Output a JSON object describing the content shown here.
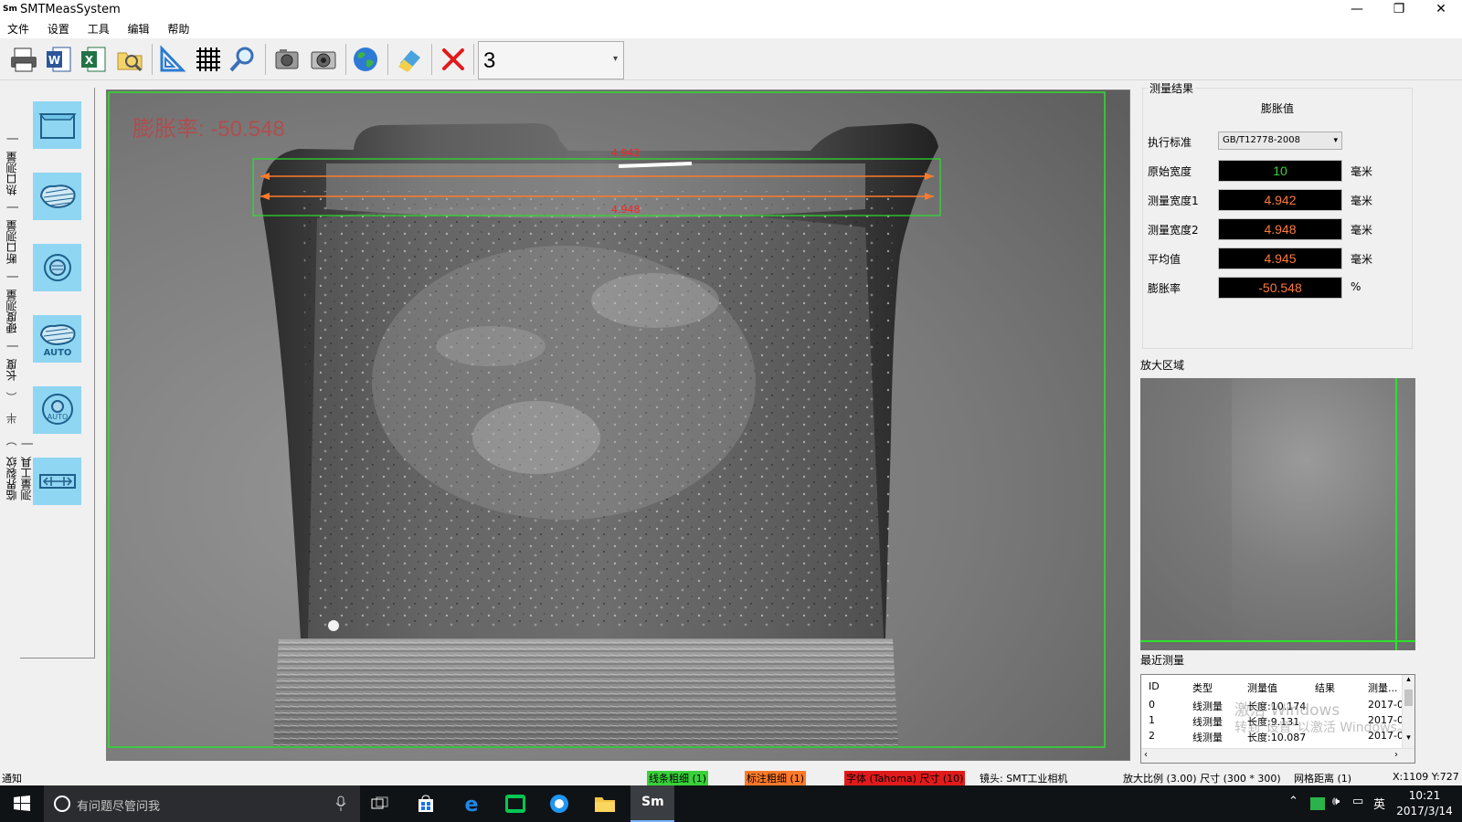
{
  "window": {
    "title": "SMTMeasSystem",
    "app_icon_text": "Sm",
    "minimize": "—",
    "maximize": "❐",
    "close": "✕"
  },
  "menu": [
    "文件",
    "设置",
    "工具",
    "编辑",
    "帮助"
  ],
  "toolbar": {
    "combo_value": "3",
    "icons": [
      "print-icon",
      "word-export-icon",
      "excel-export-icon",
      "open-image-icon",
      "ruler-icon",
      "grid-icon",
      "magnifier-icon",
      "camera-icon",
      "camera-capture-icon",
      "globe-icon",
      "eraser-icon",
      "delete-icon"
    ]
  },
  "left_tabs": [
    "测量工具",
    "|",
    "热口测量",
    "|",
    "断口测量",
    "|",
    "硬度测量",
    "|",
    "长度",
    "（",
    "半",
    "）",
    "临界裂纹",
    "|"
  ],
  "left_tools": [
    {
      "name": "rect-tool",
      "label": ""
    },
    {
      "name": "area-tool",
      "label": ""
    },
    {
      "name": "circle-tool",
      "label": ""
    },
    {
      "name": "auto-area-tool",
      "label": "AUTO"
    },
    {
      "name": "auto-circle-tool",
      "label": "AUTO"
    },
    {
      "name": "width-tool",
      "label": ""
    }
  ],
  "image": {
    "overlay_text": "膨胀率: -50.548",
    "line1_label": "4.942",
    "line2_label": "4.948"
  },
  "results": {
    "group_title": "测量结果",
    "subtitle": "膨胀值",
    "standard_label": "执行标准",
    "standard_value": "GB/T12778-2008",
    "rows": [
      {
        "label": "原始宽度",
        "value": "10",
        "unit": "毫米",
        "color": "#39d139"
      },
      {
        "label": "测量宽度1",
        "value": "4.942",
        "unit": "毫米",
        "color": "#ff7a3a"
      },
      {
        "label": "测量宽度2",
        "value": "4.948",
        "unit": "毫米",
        "color": "#ff7a3a"
      },
      {
        "label": "平均值",
        "value": "4.945",
        "unit": "毫米",
        "color": "#ff7a3a"
      },
      {
        "label": "膨胀率",
        "value": "-50.548",
        "unit": "%",
        "color": "#ff7a3a"
      }
    ]
  },
  "zoom": {
    "title": "放大区域"
  },
  "recent": {
    "title": "最近测量",
    "headers": [
      "ID",
      "类型",
      "测量值",
      "结果",
      "测量..."
    ],
    "rows": [
      {
        "id": "0",
        "type": "线测量",
        "value": "长度:10.174",
        "result": "",
        "date": "2017-0"
      },
      {
        "id": "1",
        "type": "线测量",
        "value": "长度:9.131",
        "result": "",
        "date": "2017-0"
      },
      {
        "id": "2",
        "type": "线测量",
        "value": "长度:10.087",
        "result": "",
        "date": "2017-0"
      }
    ],
    "watermark1": "激活 Windows",
    "watermark2": "转到\"设置\"以激活 Windows。"
  },
  "status": {
    "notice": "通知",
    "line_width": "线条粗细 (1)",
    "label_width": "标注粗细 (1)",
    "font": "字体 (Tahoma) 尺寸 (10)",
    "lens": "镜头: SMT工业相机",
    "scale": "放大比例 (3.00) 尺寸 (300 * 300)",
    "grid": "网格距离 (1)",
    "coords": "X:1109 Y:727"
  },
  "taskbar": {
    "search_placeholder": "有问题尽管问我",
    "ime": "英",
    "time": "10:21",
    "date": "2017/3/14"
  }
}
